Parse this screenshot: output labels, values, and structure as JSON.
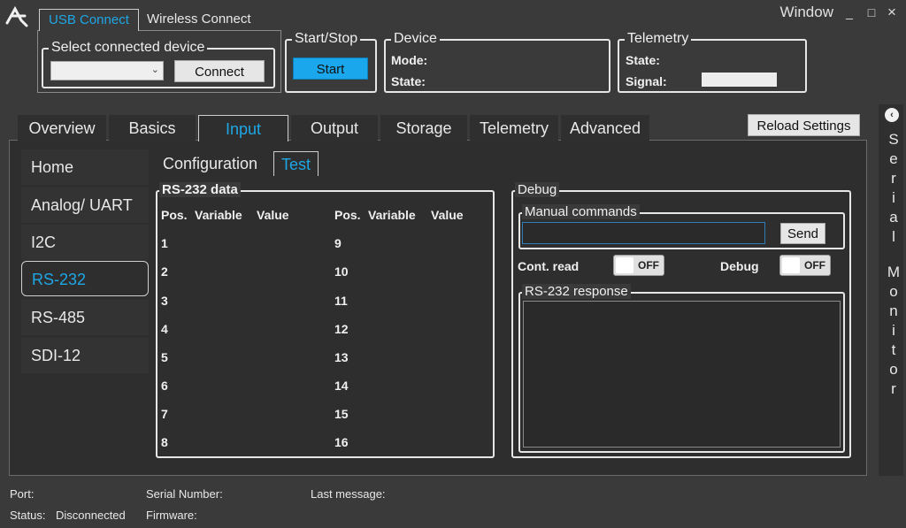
{
  "connection_tabs": {
    "usb": "USB Connect",
    "wireless": "Wireless Connect"
  },
  "window": {
    "title": "Window",
    "minimize": "_",
    "maximize": "□",
    "close": "×"
  },
  "select_device": {
    "label": "Select connected device",
    "connect": "Connect",
    "combo_value": ""
  },
  "start_stop": {
    "label": "Start/Stop",
    "start": "Start"
  },
  "device": {
    "label": "Device",
    "mode": "Mode:",
    "state": "State:"
  },
  "telemetry_box": {
    "label": "Telemetry",
    "state": "State:",
    "signal": "Signal:"
  },
  "tabs": [
    "Overview",
    "Basics",
    "Input",
    "Output",
    "Storage",
    "Telemetry",
    "Advanced"
  ],
  "reload": "Reload Settings",
  "sidebar": [
    "Home",
    "Analog/ UART",
    "I2C",
    "RS-232",
    "RS-485",
    "SDI-12"
  ],
  "subtabs": [
    "Configuration",
    "Test"
  ],
  "rs232_data": {
    "label": "RS-232 data",
    "headers": [
      "Pos.",
      "Variable",
      "Value"
    ],
    "left_positions": [
      "1",
      "2",
      "3",
      "4",
      "5",
      "6",
      "7",
      "8"
    ],
    "right_positions": [
      "9",
      "10",
      "11",
      "12",
      "13",
      "14",
      "15",
      "16"
    ]
  },
  "debug": {
    "label": "Debug",
    "manual_label": "Manual commands",
    "manual_value": "",
    "send": "Send",
    "cont_read": "Cont. read",
    "cont_toggle": "OFF",
    "debug_label": "Debug",
    "debug_toggle": "OFF",
    "response_label": "RS-232 response"
  },
  "serial_monitor": "Serial Monitor",
  "status_bar": {
    "port": "Port:",
    "serial": "Serial Number:",
    "last": "Last message:",
    "status": "Status:",
    "status_value": "Disconnected",
    "firmware": "Firmware:"
  },
  "colors": {
    "accent": "#1ea7e6",
    "start_button": "#1aa7ec"
  }
}
